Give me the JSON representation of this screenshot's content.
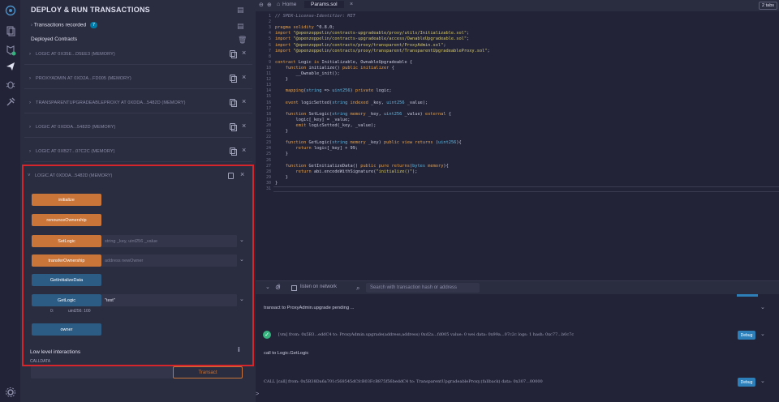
{
  "panel": {
    "title": "DEPLOY & RUN TRANSACTIONS",
    "transactions_recorded_label": "Transactions recorded",
    "transactions_recorded_count": "7",
    "deployed_contracts_label": "Deployed Contracts",
    "contracts": [
      "LOGIC AT 0X35E...D5EE3 (MEMORY)",
      "PROXYADMIN AT 0XD2A...FD005 (MEMORY)",
      "TRANSPARENTUPGRADEABLEPROXY AT 0XDDA...5482D (MEMORY)",
      "LOGIC AT 0XDDA...5482D (MEMORY)",
      "LOGIC AT 0XB27...07C2C (MEMORY)"
    ],
    "expanded": {
      "name": "LOGIC AT 0XDDA...5482D (MEMORY)",
      "functions": [
        {
          "label": "initialize",
          "color": "orange"
        },
        {
          "label": "renounceOwnership",
          "color": "orange"
        },
        {
          "label": "SetLogic",
          "color": "orange",
          "placeholder": "string _key, uint256 _value"
        },
        {
          "label": "transferOwnership",
          "color": "orange",
          "placeholder": "address newOwner"
        },
        {
          "label": "GetInitializeData",
          "color": "blue"
        },
        {
          "label": "GetLogic",
          "color": "blue",
          "value": "\"test\""
        },
        {
          "label": "owner",
          "color": "blue"
        }
      ],
      "getlogic_result_index": "0:",
      "getlogic_result": "uint256: 100",
      "low_level_label": "Low level interactions",
      "calldata_label": "CALLDATA",
      "transact_label": "Transact"
    }
  },
  "editor": {
    "home_tab": "Home",
    "file_tab": "Params.sol",
    "tabs_count": "2 tabs",
    "lines": [
      "// SPDX-License-Identifier: MIT",
      "",
      "pragma solidity ^0.8.0;",
      "import \"@openzeppelin/contracts-upgradeable/proxy/utils/Initializable.sol\";",
      "import \"@openzeppelin/contracts-upgradeable/access/OwnableUpgradeable.sol\";",
      "import \"@openzeppelin/contracts/proxy/transparent/ProxyAdmin.sol\";",
      "import \"@openzeppelin/contracts/proxy/transparent/TransparentUpgradeableProxy.sol\";",
      "",
      "contract Logic is Initializable, OwnableUpgradeable {",
      "    function initialize() public initializer {",
      "        __Ownable_init();",
      "    }",
      "",
      "    mapping(string => uint256) private logic;",
      "",
      "    event logicSetted(string indexed _key, uint256 _value);",
      "",
      "    function SetLogic(string memory _key, uint256 _value) external {",
      "        logic[_key] = _value;",
      "        emit logicSetted(_key, _value);",
      "    }",
      "",
      "    function GetLogic(string memory _key) public view returns (uint256){",
      "        return logic[_key] + 99;",
      "    }",
      "",
      "    function GetInitializeData() public pure returns(bytes memory){",
      "        return abi.encodeWithSignature(\"initialize()\");",
      "    }",
      "}",
      ""
    ]
  },
  "terminal": {
    "counter": "0",
    "listen_label": "listen on network",
    "search_placeholder": "Search with transaction hash or address",
    "pending_line": "transact to ProxyAdmin.upgrade pending ...",
    "vm_log": "[vm]  from: 0x5B3...eddC4 to: ProxyAdmin.upgrade(address,address) 0xd2a...fd005 value: 0 wei data: 0x99a...07c2c logs: 1 hash: 0xc77...b0c7c",
    "call_line": "call to Logic.GetLogic",
    "call_log": "CALL    [call]  from: 0x5B38Da6a701c568545dCfcB03FcB875f56beddC4 to: TransparentUpgradeableProxy.(fallback) data: 0x307...00000",
    "debug_label": "Debug",
    "prompt": ">"
  }
}
